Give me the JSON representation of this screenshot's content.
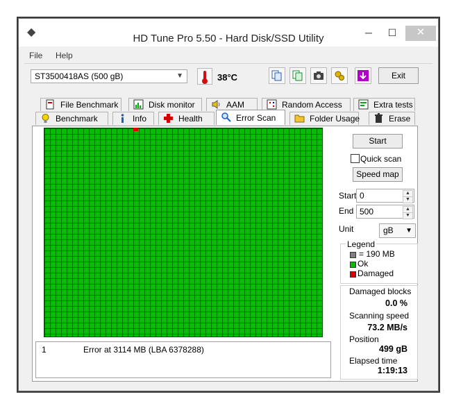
{
  "window": {
    "title": "HD Tune Pro 5.50 - Hard Disk/SSD Utility",
    "minimize": "─",
    "maximize": "☐",
    "close": "✕"
  },
  "menu": {
    "file": "File",
    "help": "Help"
  },
  "toolbar": {
    "drive": "ST3500418AS (500 gB)",
    "temperature": "38",
    "temp_unit": "°C",
    "exit_label": "Exit"
  },
  "tabs_top": [
    "File Benchmark",
    "Disk monitor",
    "AAM",
    "Random Access",
    "Extra tests"
  ],
  "tabs_bottom": [
    "Benchmark",
    "Info",
    "Health",
    "Error Scan",
    "Folder Usage",
    "Erase"
  ],
  "active_tab": "Error Scan",
  "scan": {
    "start_button": "Start",
    "quick_scan_label": "Quick scan",
    "quick_scan_checked": false,
    "speed_map_button": "Speed map",
    "start_label": "Start",
    "start_value": "0",
    "end_label": "End",
    "end_value": "500",
    "unit_label": "Unit",
    "unit_value": "gB",
    "legend_title": "Legend",
    "legend_items": [
      {
        "color": "#808080",
        "label": "= 190 MB"
      },
      {
        "color": "#00c000",
        "label": "Ok"
      },
      {
        "color": "#e00000",
        "label": "Damaged"
      }
    ],
    "stats": {
      "damaged_blocks_label": "Damaged blocks",
      "damaged_blocks_value": "0.0 %",
      "scanning_speed_label": "Scanning speed",
      "scanning_speed_value": "73.2 MB/s",
      "position_label": "Position",
      "position_value": "499 gB",
      "elapsed_label": "Elapsed time",
      "elapsed_value": "1:19:13"
    },
    "log": [
      {
        "index": "1",
        "message": "Error at 3114 MB (LBA 6378288)"
      }
    ]
  },
  "colors": {
    "ok": "#00c000",
    "damaged": "#e00000",
    "grid_line": "#007000"
  }
}
